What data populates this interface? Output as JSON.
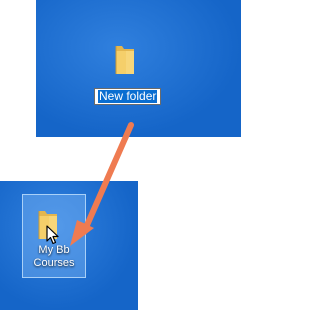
{
  "top_panel": {
    "folder_icon": "folder-icon",
    "rename_value": "New folder"
  },
  "bottom_panel": {
    "folder_icon": "folder-icon",
    "item_label_line1": "My Bb",
    "item_label_line2": "Courses"
  },
  "annotation": {
    "arrow_icon": "orange-arrow-icon",
    "arrow_color": "#ef7b51"
  },
  "colors": {
    "desktop_blue": "#1565c8",
    "selection_highlight": "#0a6ed1",
    "folder_yellow": "#f5cf6a"
  }
}
